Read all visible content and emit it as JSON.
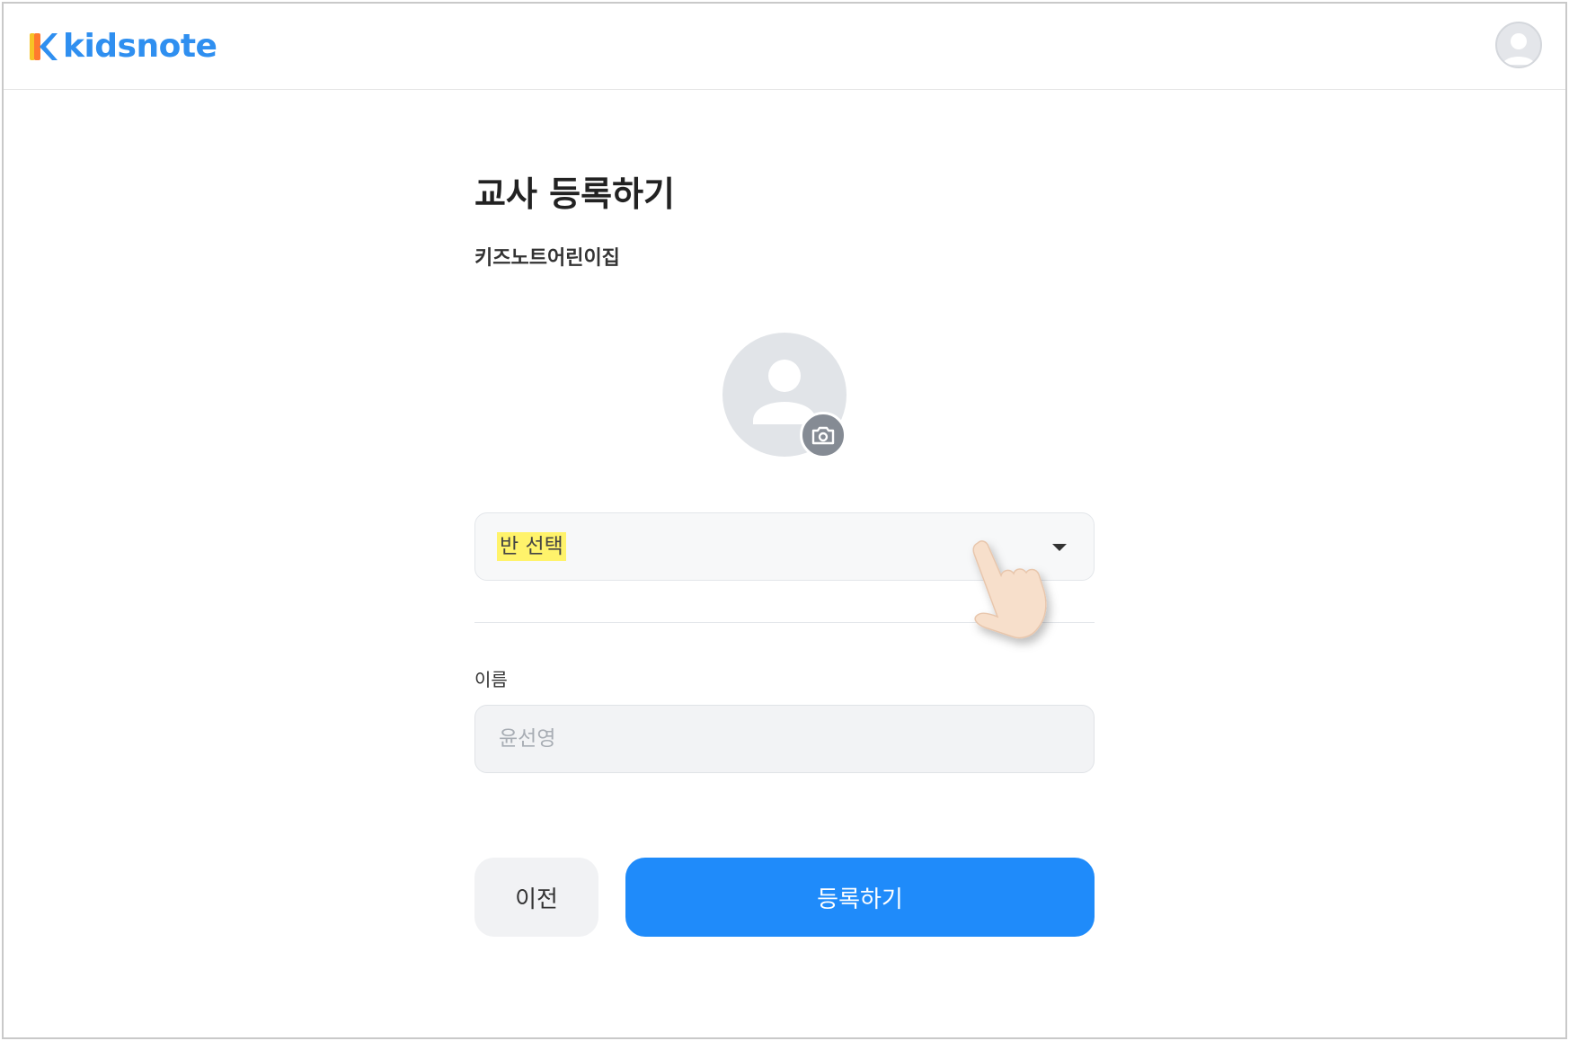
{
  "header": {
    "brand": "kidsnote",
    "avatar_icon": "user-avatar-icon"
  },
  "main": {
    "title": "교사 등록하기",
    "school_name": "키즈노트어린이집",
    "profile_photo_icon": "default-user-icon",
    "camera_icon": "camera-icon",
    "class_select": {
      "value": "반 선택",
      "caret_icon": "caret-down-icon",
      "highlight_color": "#fff36b"
    },
    "name_field": {
      "label": "이름",
      "placeholder": "윤선영"
    },
    "buttons": {
      "prev_label": "이전",
      "submit_label": "등록하기"
    }
  },
  "colors": {
    "brand": "#2f8ff0",
    "primary": "#1f8bfa"
  }
}
